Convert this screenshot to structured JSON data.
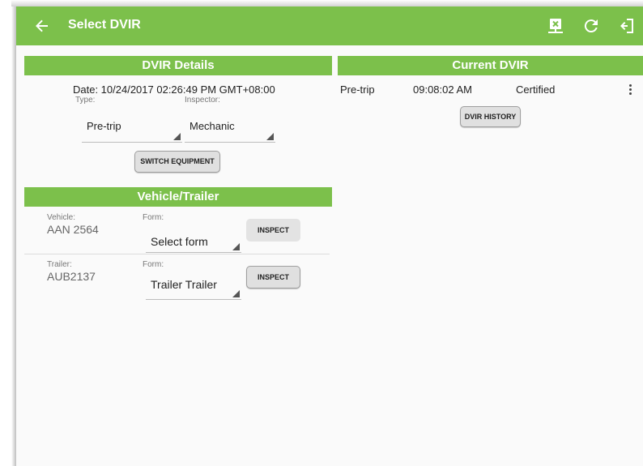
{
  "appbar": {
    "title": "Select DVIR",
    "icons": [
      "arrow-back-icon",
      "cancel-inspection-icon",
      "refresh-icon",
      "logout-icon"
    ]
  },
  "dvir_details": {
    "header": "DVIR Details",
    "date": "Date: 10/24/2017 02:26:49 PM GMT+08:00",
    "type_label": "Type:",
    "type_value": "Pre-trip",
    "inspector_label": "Inspector:",
    "inspector_value": "Mechanic",
    "switch_equipment_label": "SWITCH EQUIPMENT"
  },
  "vehicle_trailer": {
    "header": "Vehicle/Trailer",
    "rows": [
      {
        "unit_label": "Vehicle:",
        "unit_value": "AAN 2564",
        "form_label": "Form:",
        "form_value": "Select form",
        "inspect_label": "INSPECT"
      },
      {
        "unit_label": "Trailer:",
        "unit_value": "AUB2137",
        "form_label": "Form:",
        "form_value": "Trailer Trailer",
        "inspect_label": "INSPECT"
      }
    ]
  },
  "current_dvir": {
    "header": "Current DVIR",
    "entries": [
      {
        "type": "Pre-trip",
        "time": "09:08:02 AM",
        "status": "Certified"
      }
    ],
    "history_label": "DVIR HISTORY"
  },
  "colors": {
    "accent": "#7cc04b",
    "background": "#fafafa"
  }
}
